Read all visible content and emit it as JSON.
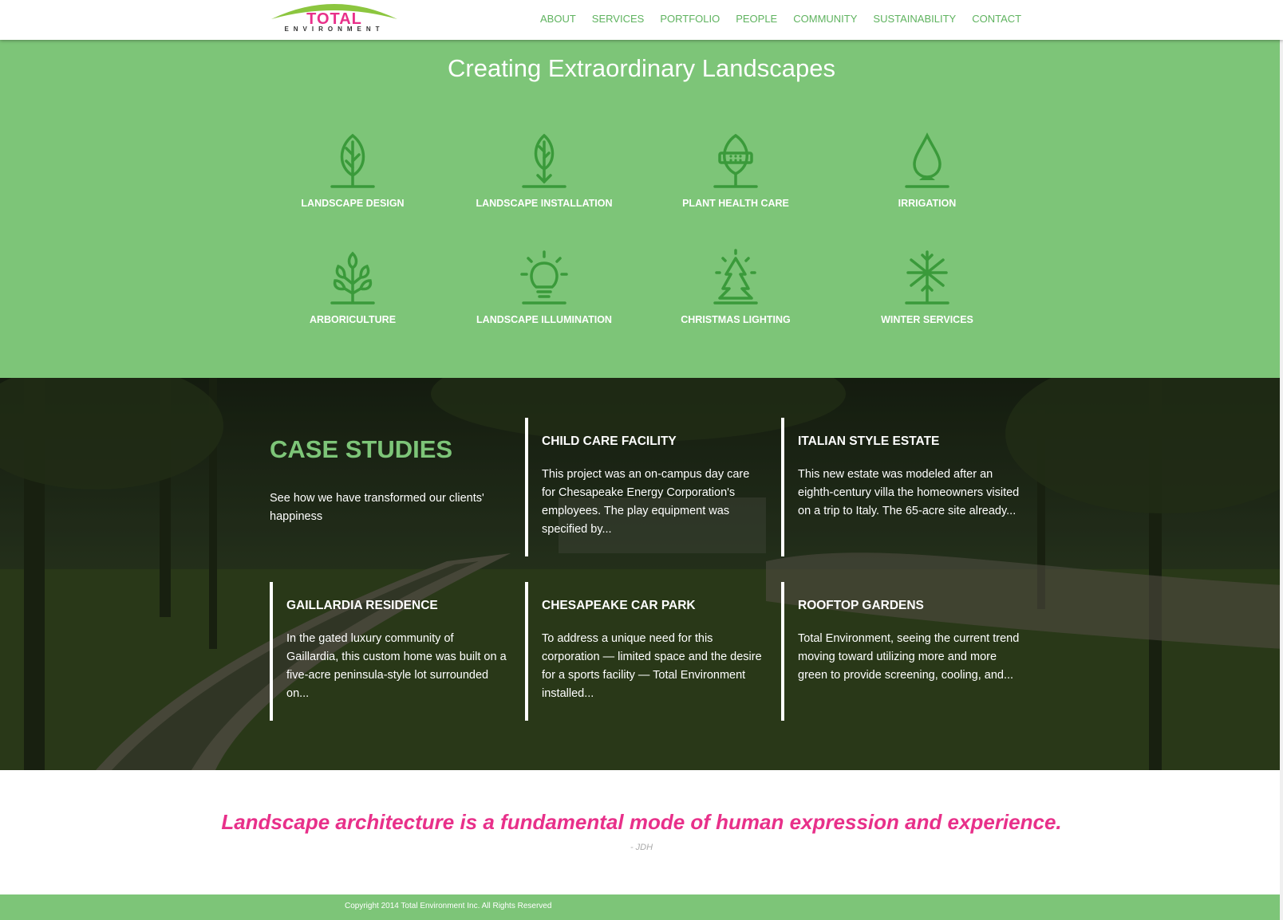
{
  "header": {
    "logo_word": "TOTAL",
    "logo_sub": "ENVIRONMENT",
    "nav": [
      "ABOUT",
      "SERVICES",
      "PORTFOLIO",
      "PEOPLE",
      "COMMUNITY",
      "SUSTAINABILITY",
      "CONTACT"
    ]
  },
  "services": {
    "title": "Creating Extraordinary Landscapes",
    "items": [
      {
        "label": "LANDSCAPE DESIGN",
        "icon": "leaf-tree-icon"
      },
      {
        "label": "LANDSCAPE INSTALLATION",
        "icon": "leaf-plant-arrow-icon"
      },
      {
        "label": "PLANT HEALTH CARE",
        "icon": "bandaged-tree-icon"
      },
      {
        "label": "IRRIGATION",
        "icon": "water-drop-icon"
      },
      {
        "label": "ARBORICULTURE",
        "icon": "branching-tree-icon"
      },
      {
        "label": "LANDSCAPE ILLUMINATION",
        "icon": "light-bulb-icon"
      },
      {
        "label": "CHRISTMAS LIGHTING",
        "icon": "christmas-tree-icon"
      },
      {
        "label": "WINTER SERVICES",
        "icon": "snowflake-tree-icon"
      }
    ]
  },
  "case_studies": {
    "title": "CASE STUDIES",
    "subtitle": "See how we have transformed our clients' happiness",
    "cards": [
      {
        "title": "CHILD CARE FACILITY",
        "text": "This project was an on-campus day care for Chesapeake Energy Corporation's employees. The play equipment was specified by..."
      },
      {
        "title": "ITALIAN STYLE ESTATE",
        "text": "This new estate was modeled after an eighth-century villa the homeowners visited on a trip to Italy. The 65-acre site already..."
      },
      {
        "title": "GAILLARDIA RESIDENCE",
        "text": "In the gated luxury community of Gaillardia, this custom home was built on a five-acre peninsula-style lot surrounded on..."
      },
      {
        "title": "CHESAPEAKE CAR PARK",
        "text": "To address a unique need for this corporation — limited space and the desire for a sports facility — Total Environment installed..."
      },
      {
        "title": "ROOFTOP GARDENS",
        "text": "Total Environment, seeing the current trend moving toward utilizing more and more green to provide screening, cooling, and..."
      }
    ]
  },
  "quote": {
    "text": "Landscape architecture is a fundamental mode of human expression and experience.",
    "author": "- JDH"
  },
  "footer": {
    "copyright": "Copyright 2014 Total Environment Inc. All Rights Reserved"
  },
  "colors": {
    "brand_green": "#7dc578",
    "icon_green": "#3a9a3a",
    "brand_pink": "#e8308a"
  }
}
